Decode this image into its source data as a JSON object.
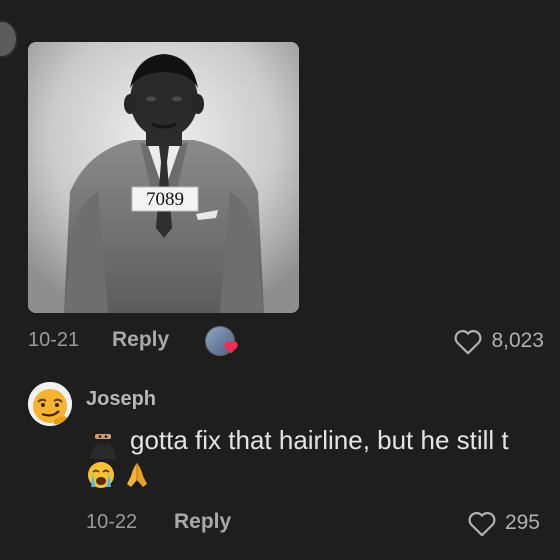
{
  "post": {
    "badge_number": "7089",
    "date": "10-21",
    "reply_label": "Reply",
    "like_count": "8,023",
    "creator_liked": true
  },
  "comment": {
    "username": "Joseph",
    "text": "gotta fix that hairline, but he still t",
    "emojis": [
      "😭",
      "🙏"
    ],
    "date": "10-22",
    "reply_label": "Reply",
    "like_count": "295"
  },
  "colors": {
    "background": "#1e1e1e",
    "creator_heart": "#fe2c55",
    "secondary_text": "#9b9b9b"
  }
}
